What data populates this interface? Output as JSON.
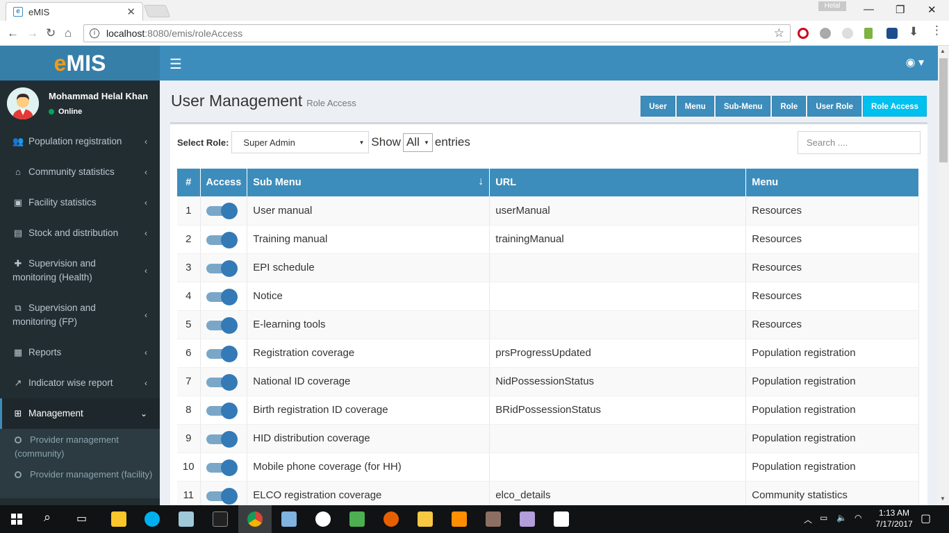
{
  "browser": {
    "tab_title": "eMIS",
    "url_host": "localhost",
    "url_path": ":8080/emis/roleAccess",
    "profile_name": "Helal"
  },
  "app": {
    "logo_e": "e",
    "logo_rest": "MIS"
  },
  "user": {
    "name": "Mohammad Helal Khan",
    "status": "Online"
  },
  "sidebar": {
    "items": [
      {
        "label": "Population registration",
        "icon": "users-icon"
      },
      {
        "label": "Community statistics",
        "icon": "home-icon"
      },
      {
        "label": "Facility statistics",
        "icon": "medkit-icon"
      },
      {
        "label": "Stock and distribution",
        "icon": "cubes-icon"
      },
      {
        "label": "Supervision and monitoring (Health)",
        "icon": "plus-icon"
      },
      {
        "label": "Supervision and monitoring (FP)",
        "icon": "binoculars-icon"
      },
      {
        "label": "Reports",
        "icon": "report-icon"
      },
      {
        "label": "Indicator wise report",
        "icon": "chart-icon"
      },
      {
        "label": "Management",
        "icon": "sitemap-icon"
      }
    ],
    "submenu": [
      {
        "label": "Provider management (community)"
      },
      {
        "label": "Provider management (facility)"
      }
    ]
  },
  "page": {
    "title": "User Management",
    "subtitle": "Role Access",
    "buttons": [
      "User",
      "Menu",
      "Sub-Menu",
      "Role",
      "User Role",
      "Role Access"
    ],
    "active_button": "Role Access"
  },
  "filters": {
    "role_label": "Select Role:",
    "role_value": "Super Admin",
    "show_text": "Show",
    "length_value": "All",
    "entries_text": "entries",
    "search_placeholder": "Search ...."
  },
  "table": {
    "headers": [
      "#",
      "Access",
      "Sub Menu",
      "URL",
      "Menu"
    ],
    "rows": [
      {
        "num": "1",
        "access": true,
        "sub_menu": "User manual",
        "url": "userManual",
        "menu": "Resources"
      },
      {
        "num": "2",
        "access": true,
        "sub_menu": "Training manual",
        "url": "trainingManual",
        "menu": "Resources"
      },
      {
        "num": "3",
        "access": true,
        "sub_menu": "EPI schedule",
        "url": "",
        "menu": "Resources"
      },
      {
        "num": "4",
        "access": true,
        "sub_menu": "Notice",
        "url": "",
        "menu": "Resources"
      },
      {
        "num": "5",
        "access": true,
        "sub_menu": "E-learning tools",
        "url": "",
        "menu": "Resources"
      },
      {
        "num": "6",
        "access": true,
        "sub_menu": "Registration coverage",
        "url": "prsProgressUpdated",
        "menu": "Population registration"
      },
      {
        "num": "7",
        "access": true,
        "sub_menu": "National ID coverage",
        "url": "NidPossessionStatus",
        "menu": "Population registration"
      },
      {
        "num": "8",
        "access": true,
        "sub_menu": "Birth registration ID coverage",
        "url": "BRidPossessionStatus",
        "menu": "Population registration"
      },
      {
        "num": "9",
        "access": true,
        "sub_menu": "HID distribution coverage",
        "url": "",
        "menu": "Population registration"
      },
      {
        "num": "10",
        "access": true,
        "sub_menu": "Mobile phone coverage (for HH)",
        "url": "",
        "menu": "Population registration"
      },
      {
        "num": "11",
        "access": true,
        "sub_menu": "ELCO registration coverage",
        "url": "elco_details",
        "menu": "Community statistics"
      }
    ]
  },
  "taskbar": {
    "time": "1:13 AM",
    "date": "7/17/2017"
  },
  "colors": {
    "primary": "#3c8dbc",
    "active_button": "#00c0ef",
    "sidebar_bg": "#222d32",
    "logo_accent": "#f39c12"
  }
}
